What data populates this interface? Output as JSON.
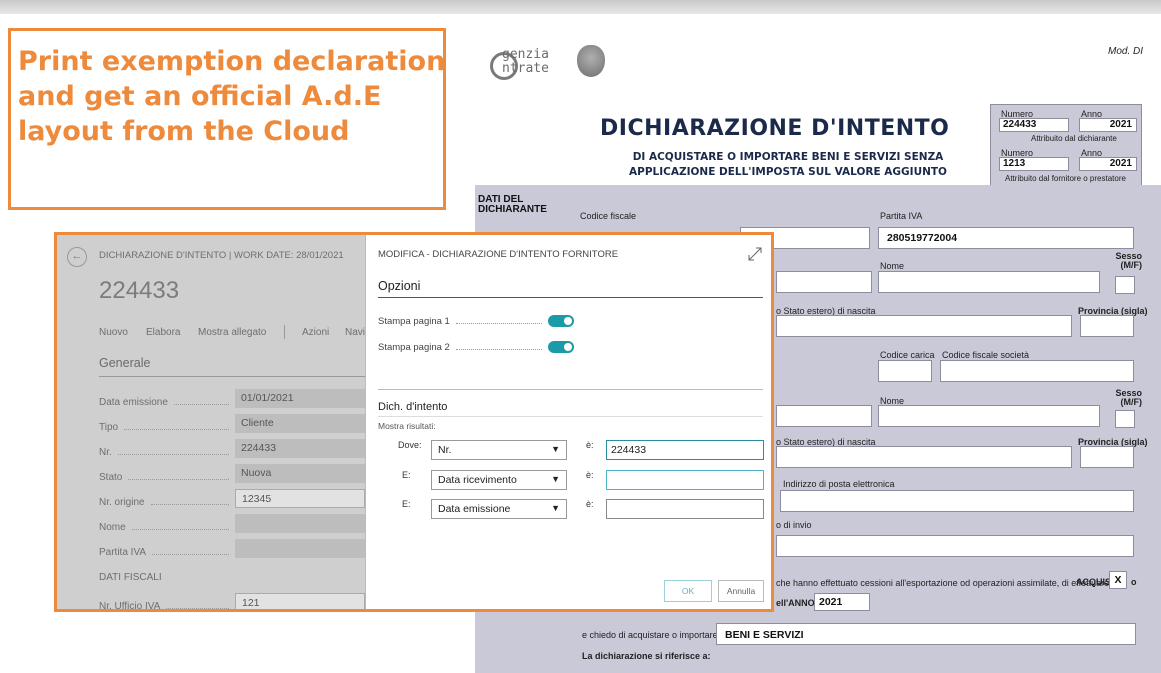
{
  "callout": {
    "text": "Print exemption declaration and get an official A.d.E layout from the Cloud"
  },
  "form": {
    "logo_line1": "genzia",
    "logo_line2": "ntrate",
    "mod_label": "Mod. DI",
    "title": "DICHIARAZIONE D'INTENTO",
    "subtitle": "DI ACQUISTARE O IMPORTARE BENI E SERVIZI SENZA APPLICAZIONE DELL'IMPOSTA SUL VALORE AGGIUNTO",
    "numero_label": "Numero",
    "anno_label": "Anno",
    "numero1": "224433",
    "anno1": "2021",
    "attrib1": "Attribuito dal dichiarante",
    "numero2": "1213",
    "anno2": "2021",
    "attrib2": "Attribuito dal fornitore o prestatore",
    "section_label": "DATI DEL DICHIARANTE",
    "codice_fiscale": "Codice fiscale",
    "partita_iva": "Partita IVA",
    "piva_value": "280519772004",
    "nome": "Nome",
    "sesso": "Sesso (M/F)",
    "stato_nascita": "o Stato estero) di nascita",
    "provincia": "Provincia (sigla)",
    "codice_carica": "Codice carica",
    "cf_societa": "Codice fiscale società",
    "nome2": "Nome",
    "sesso2": "Sesso (M/F)",
    "stato_nascita2": "o Stato estero) di nascita",
    "provincia2": "Provincia (sigla)",
    "email": "Indirizzo di posta elettronica",
    "invio": "o di invio",
    "cessioni_text": "che hanno effettuato cessioni all'esportazione od operazioni assimilate, di effettuare",
    "acquisti": "ACQUISTI",
    "acquisti_mark": "X",
    "acquisti_suffix": "o",
    "anno_text": "ell'ANNO",
    "anno_value": "2021",
    "chiedo": "e chiedo di acquistare o importare",
    "beni_servizi": "BENI E SERVIZI",
    "riferisce": "La dichiarazione si riferisce a:"
  },
  "record": {
    "header": "DICHIARAZIONE D'INTENTO | WORK DATE: 28/01/2021",
    "number": "224433",
    "actions": [
      "Nuovo",
      "Elabora",
      "Mostra allegato",
      "Azioni",
      "Navi"
    ],
    "section": "Generale",
    "fields": [
      {
        "label": "Data emissione",
        "value": "01/01/2021"
      },
      {
        "label": "Tipo",
        "value": "Cliente"
      },
      {
        "label": "Nr.",
        "value": "224433"
      },
      {
        "label": "Stato",
        "value": "Nuova"
      },
      {
        "label": "Nr. origine",
        "value": "12345"
      },
      {
        "label": "Nome",
        "value": ""
      },
      {
        "label": "Partita IVA",
        "value": ""
      }
    ],
    "fiscal_section": "DATI FISCALI",
    "ufficio_label": "Nr. Ufficio IVA",
    "ufficio_value": "121"
  },
  "dialog": {
    "title": "MODIFICA - DICHIARAZIONE D'INTENTO FORNITORE",
    "options_header": "Opzioni",
    "toggle1_label": "Stampa pagina 1",
    "toggle1_on": true,
    "toggle2_label": "Stampa pagina 2",
    "toggle2_on": true,
    "filter_header": "Dich. d'intento",
    "show_results": "Mostra risultati:",
    "filters": [
      {
        "prefix": "Dove:",
        "field": "Nr.",
        "eq": "è:",
        "value": "224433"
      },
      {
        "prefix": "E:",
        "field": "Data ricevimento",
        "eq": "è:",
        "value": ""
      },
      {
        "prefix": "E:",
        "field": "Data emissione",
        "eq": "è:",
        "value": ""
      }
    ],
    "ok_label": "OK",
    "cancel_label": "Annulla"
  }
}
